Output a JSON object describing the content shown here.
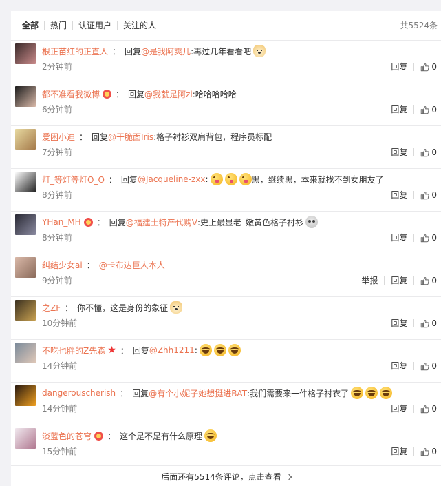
{
  "filters": {
    "tabs": [
      "全部",
      "热门",
      "认证用户",
      "关注的人"
    ],
    "total": "共5524条"
  },
  "action_labels": {
    "report": "举报",
    "reply": "回复"
  },
  "comments": [
    {
      "user": "根正苗红的正直人",
      "reply_word": "回复",
      "mention": "@是我阿爽儿",
      "text": ":再过几年看看吧",
      "emojis": [
        "doge"
      ],
      "badge": "",
      "time": "2分钟前",
      "likes": "0",
      "avatar_colors": [
        "#3a2a2a",
        "#c98a8a"
      ]
    },
    {
      "user": "都不准看我微博",
      "reply_word": "回复",
      "mention": "@我就是阿zi",
      "text": ":哈哈哈哈哈",
      "emojis": [],
      "badge": "vip",
      "time": "6分钟前",
      "likes": "0",
      "avatar_colors": [
        "#1c1c1c",
        "#d8b8a8"
      ]
    },
    {
      "user": "爱困小迪",
      "reply_word": "回复",
      "mention": "@干脆面Iris",
      "text": ":格子衬衫双肩背包，程序员标配",
      "emojis": [],
      "badge": "",
      "time": "7分钟前",
      "likes": "0",
      "avatar_colors": [
        "#e7d9a0",
        "#a57a4a"
      ]
    },
    {
      "user": "灯_等灯等灯O_O",
      "reply_word": "回复",
      "mention": "@Jacqueline-zxx",
      "text": ":",
      "emojis": [
        "yum",
        "yum",
        "yum"
      ],
      "text2": "黑，继续黑，本来就找不到女朋友了",
      "badge": "",
      "time": "8分钟前",
      "likes": "0",
      "avatar_colors": [
        "#ffffff",
        "#222222"
      ]
    },
    {
      "user": "YHan_MH",
      "reply_word": "回复",
      "mention": "@福建土特产代购V",
      "text": ":史上最显老_嫩黄色格子衬衫",
      "emojis": [
        "skull"
      ],
      "badge": "vip",
      "time": "8分钟前",
      "likes": "0",
      "avatar_colors": [
        "#2a2a35",
        "#8a8aa0"
      ]
    },
    {
      "user": "纠结少女ai",
      "reply_word": "",
      "mention": "@卡布达巨人本人",
      "text": "",
      "emojis": [],
      "badge": "",
      "time": "9分钟前",
      "likes": "0",
      "report": true,
      "avatar_colors": [
        "#d9b8a8",
        "#8a6a5a"
      ]
    },
    {
      "user": "之ZF",
      "reply_word": "",
      "mention": "",
      "text": "你不懂，这是身份的象征",
      "emojis": [
        "doge"
      ],
      "badge": "",
      "time": "10分钟前",
      "likes": "0",
      "avatar_colors": [
        "#3a3020",
        "#c7a050"
      ]
    },
    {
      "user": "不吃也胖的Z先森",
      "reply_word": "回复",
      "mention": "@Zhh1211",
      "text": ":",
      "emojis": [
        "laugh",
        "laugh",
        "laugh"
      ],
      "badge": "star",
      "time": "14分钟前",
      "likes": "0",
      "avatar_colors": [
        "#7a8a9a",
        "#e0c8b8"
      ]
    },
    {
      "user": "dangerouscherish",
      "reply_word": "回复",
      "mention": "@有个小妮子她想挺进BAT",
      "text": ":我们需要来一件格子衬衣了",
      "emojis": [
        "laugh",
        "laugh",
        "laugh"
      ],
      "badge": "",
      "time": "14分钟前",
      "likes": "0",
      "avatar_colors": [
        "#2a1a10",
        "#f0a020"
      ]
    },
    {
      "user": "淡蓝色的苍穹",
      "reply_word": "",
      "mention": "",
      "text": "这个是不是有什么原理",
      "emojis": [
        "laugh"
      ],
      "badge": "vip",
      "time": "15分钟前",
      "likes": "0",
      "avatar_colors": [
        "#f0e8ee",
        "#b07890"
      ]
    }
  ],
  "more": {
    "label": "后面还有5514条评论，点击查看"
  }
}
